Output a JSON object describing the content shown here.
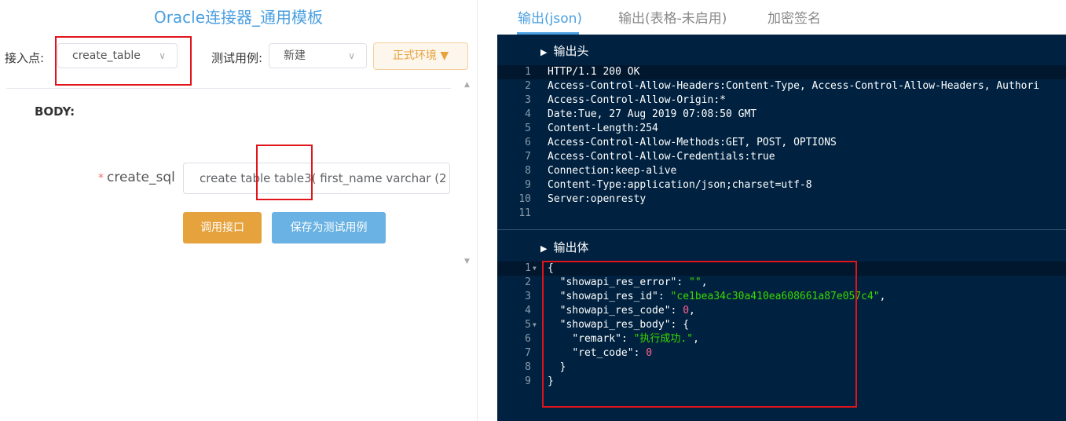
{
  "left": {
    "title": "Oracle连接器_通用模板",
    "access_point_label": "接入点:",
    "access_point_value": "create_table",
    "test_case_label": "测试用例:",
    "test_case_value": "新建",
    "env_button": "正式环境 ▼",
    "body_title": "BODY:",
    "field_label": "create_sql",
    "field_value": "create table table3( first_name varchar  (2",
    "call_button": "调用接口",
    "save_button": "保存为测试用例"
  },
  "right": {
    "tabs": [
      {
        "label": "输出(json)"
      },
      {
        "label": "输出(表格-未启用)"
      },
      {
        "label": "加密签名"
      }
    ],
    "header_section": "输出头",
    "body_section": "输出体",
    "header_lines": [
      "HTTP/1.1 200 OK",
      "Access-Control-Allow-Headers:Content-Type, Access-Control-Allow-Headers, Authori",
      "Access-Control-Allow-Origin:*",
      "Date:Tue, 27 Aug 2019 07:08:50 GMT",
      "Content-Length:254",
      "Access-Control-Allow-Methods:GET, POST, OPTIONS",
      "Access-Control-Allow-Credentials:true",
      "Connection:keep-alive",
      "Content-Type:application/json;charset=utf-8",
      "Server:openresty",
      ""
    ],
    "body_json": {
      "error_key": "\"showapi_res_error\"",
      "error_val": "\"\"",
      "id_key": "\"showapi_res_id\"",
      "id_val": "\"ce1bea34c30a410ea608661a87e057c4\"",
      "code_key": "\"showapi_res_code\"",
      "code_val": "0",
      "body_key": "\"showapi_res_body\"",
      "remark_key": "\"remark\"",
      "remark_val": "\"执行成功.\"",
      "ret_key": "\"ret_code\"",
      "ret_val": "0"
    }
  }
}
